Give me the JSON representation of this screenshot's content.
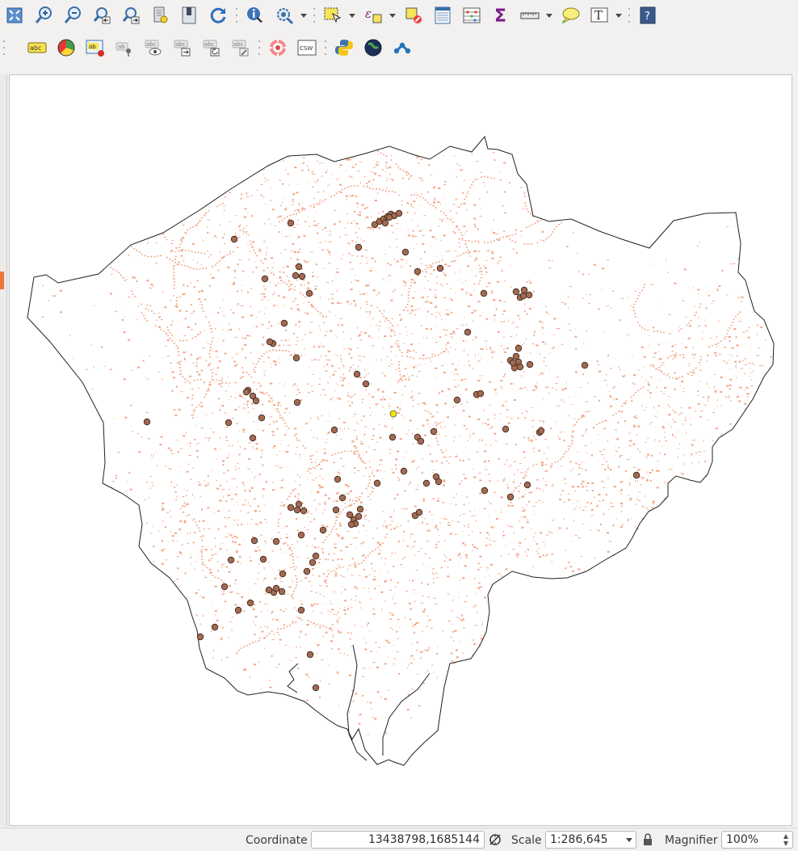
{
  "toolbar_top": {
    "buttons": [
      {
        "name": "zoom-full-button",
        "icon": "zoom-full-icon"
      },
      {
        "name": "zoom-in-button",
        "icon": "zoom-in-icon"
      },
      {
        "name": "zoom-out-button",
        "icon": "zoom-out-icon"
      },
      {
        "name": "zoom-last-button",
        "icon": "zoom-last-icon"
      },
      {
        "name": "zoom-next-button",
        "icon": "zoom-next-icon"
      },
      {
        "name": "zoom-to-layer-button",
        "icon": "zoom-layer-icon"
      },
      {
        "name": "new-bookmark-button",
        "icon": "bookmark-icon"
      },
      {
        "name": "refresh-button",
        "icon": "refresh-icon"
      },
      {
        "name": "identify-button",
        "icon": "identify-icon"
      },
      {
        "name": "map-tips-button",
        "icon": "magnifier-gear-icon"
      },
      {
        "name": "select-features-button",
        "icon": "select-rectangle-icon"
      },
      {
        "name": "select-by-expression-button",
        "icon": "expression-select-icon"
      },
      {
        "name": "deselect-features-button",
        "icon": "deselect-icon"
      },
      {
        "name": "open-attribute-table-button",
        "icon": "attribute-table-icon"
      },
      {
        "name": "field-calculator-button",
        "icon": "abacus-icon"
      },
      {
        "name": "statistical-summary-button",
        "icon": "sigma-icon"
      },
      {
        "name": "measure-line-button",
        "icon": "ruler-icon"
      },
      {
        "name": "annotation-button",
        "icon": "speech-bubble-icon"
      },
      {
        "name": "text-annotation-button",
        "icon": "text-annotation-icon"
      },
      {
        "name": "help-button",
        "icon": "help-icon"
      }
    ]
  },
  "toolbar_labels": {
    "buttons": [
      {
        "name": "label-toolbar-button",
        "icon": "label-abc-icon",
        "text": "abc"
      },
      {
        "name": "layer-diagram-button",
        "icon": "pie-diagram-icon"
      },
      {
        "name": "highlight-pinned-labels-button",
        "icon": "pin-label-icon",
        "text": "ab"
      },
      {
        "name": "pin-labels-button",
        "icon": "pin-icon",
        "text": "ab"
      },
      {
        "name": "show-hide-labels-button",
        "icon": "eye-label-icon",
        "text": "abc"
      },
      {
        "name": "move-label-button",
        "icon": "move-label-icon",
        "text": "abc"
      },
      {
        "name": "rotate-label-button",
        "icon": "rotate-label-icon",
        "text": "abc"
      },
      {
        "name": "change-label-button",
        "icon": "edit-label-icon",
        "text": "abc"
      },
      {
        "name": "target-plugin-button",
        "icon": "target-icon"
      },
      {
        "name": "csw-button",
        "icon": "csw-icon",
        "text": "CSW"
      },
      {
        "name": "python-console-button",
        "icon": "python-icon"
      },
      {
        "name": "globe-button",
        "icon": "globe-icon"
      },
      {
        "name": "network-button",
        "icon": "network-icon"
      }
    ]
  },
  "map": {
    "layers": [
      "boundary-polygon",
      "landuse-raster",
      "point-features",
      "selected-point"
    ],
    "boundary_stroke": "#202020",
    "raster_color": "#f1a585",
    "point_fill": "#a36a52",
    "point_stroke": "#3a2418",
    "selected_point_fill": "#f2e600"
  },
  "statusbar": {
    "coordinate_label": "Coordinate",
    "coordinate_value": "13438798,1685144",
    "scale_label": "Scale",
    "scale_value": "1:286,645",
    "magnifier_label": "Magnifier",
    "magnifier_value": "100%"
  }
}
